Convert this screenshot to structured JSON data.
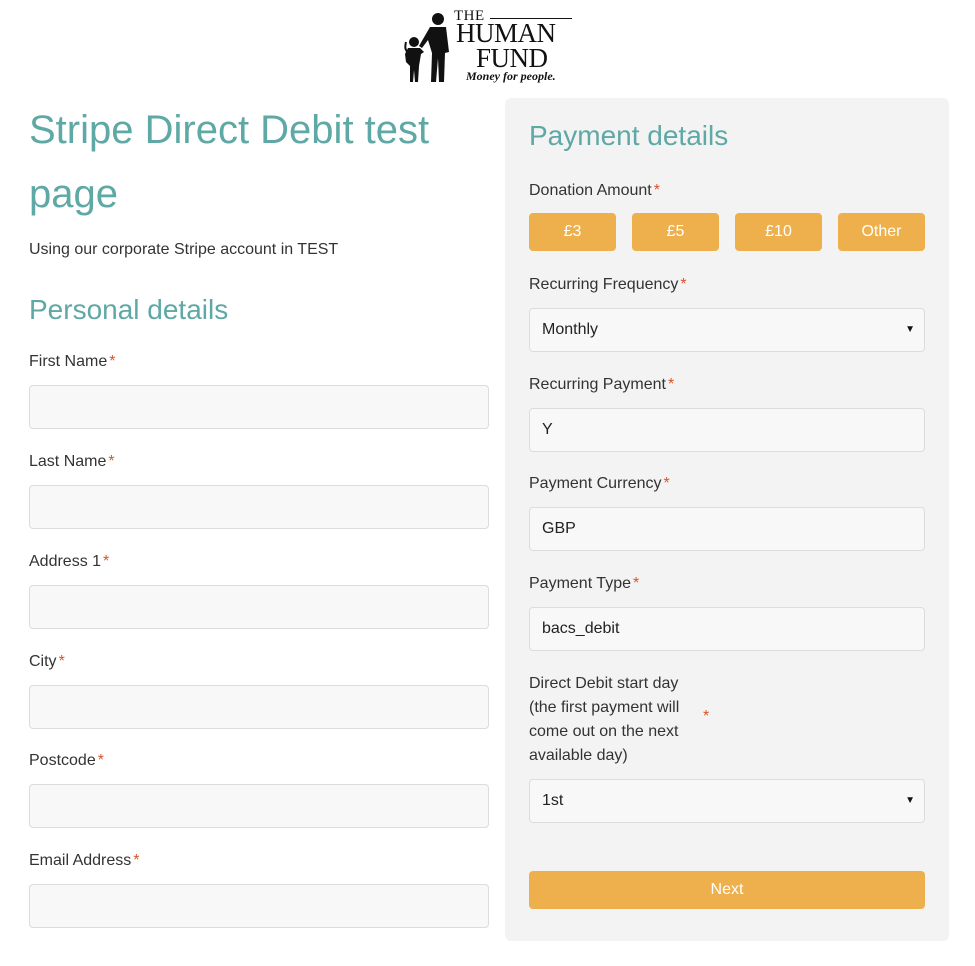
{
  "logo": {
    "the": "THE",
    "human": "HUMAN",
    "fund": "FUND",
    "tagline": "Money for people."
  },
  "page": {
    "title": "Stripe Direct Debit test page",
    "subtitle": "Using our corporate Stripe account in TEST"
  },
  "personal": {
    "heading": "Personal details",
    "required_mark": "*",
    "fields": [
      {
        "label": "First Name",
        "value": ""
      },
      {
        "label": "Last Name",
        "value": ""
      },
      {
        "label": "Address 1",
        "value": ""
      },
      {
        "label": "City",
        "value": ""
      },
      {
        "label": "Postcode",
        "value": ""
      },
      {
        "label": "Email Address",
        "value": ""
      }
    ]
  },
  "payment": {
    "heading": "Payment details",
    "donation_label": "Donation Amount",
    "amounts": [
      "£3",
      "£5",
      "£10",
      "Other"
    ],
    "frequency_label": "Recurring Frequency",
    "frequency_value": "Monthly",
    "recurring_label": "Recurring Payment",
    "recurring_value": "Y",
    "currency_label": "Payment Currency",
    "currency_value": "GBP",
    "type_label": "Payment Type",
    "type_value": "bacs_debit",
    "start_day_label": "Direct Debit start day (the first payment will come out on the next available day)",
    "start_day_value": "1st",
    "next_label": "Next"
  },
  "colors": {
    "accent_teal": "#5ea8a5",
    "button_orange": "#eeb04c",
    "required_red": "#d9542c",
    "panel_bg": "#f3f3f3"
  },
  "icons": {
    "select_caret": "▼"
  }
}
